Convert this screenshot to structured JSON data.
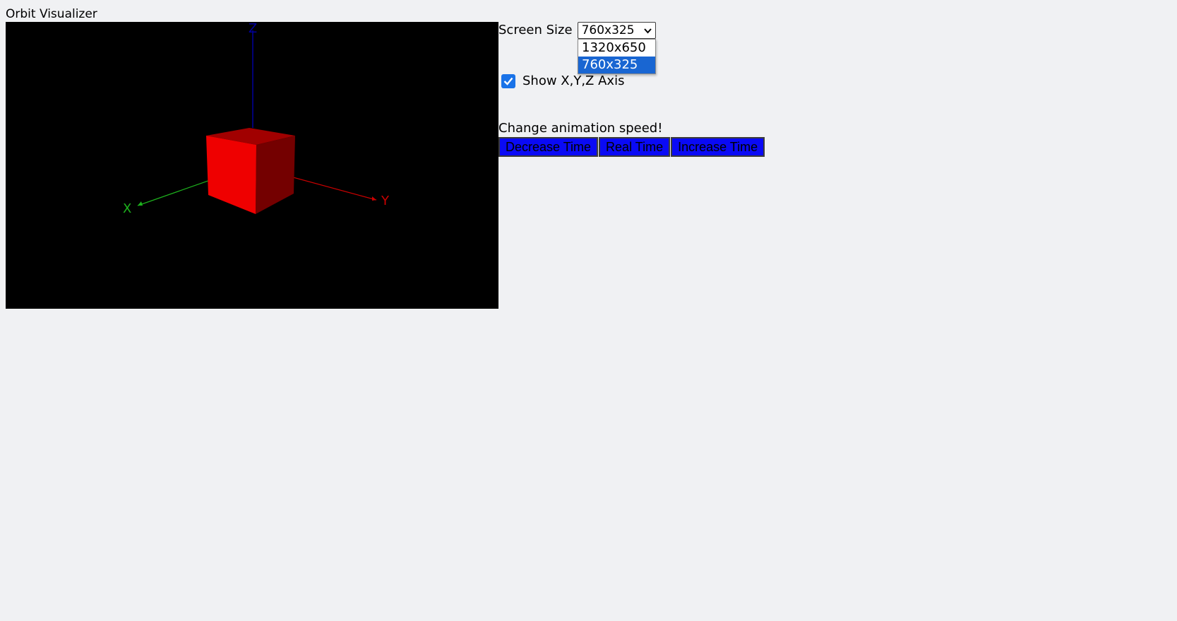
{
  "app": {
    "title": "Orbit Visualizer"
  },
  "scene": {
    "axes": {
      "x_label": "X",
      "y_label": "Y",
      "z_label": "Z"
    },
    "colors": {
      "background": "#000000",
      "x_axis": "#1db11d",
      "y_axis": "#cc0000",
      "z_axis": "#00009c",
      "cube_front": "#ef0000",
      "cube_top": "#a10000",
      "cube_side": "#740000"
    }
  },
  "controls": {
    "screen_size": {
      "label": "Screen Size",
      "selected": "760x325",
      "options": [
        "1320x650",
        "760x325"
      ]
    },
    "show_axis": {
      "label": "Show X,Y,Z Axis",
      "checked": true
    },
    "speed": {
      "label": "Change animation speed!",
      "decrease": "Decrease Time",
      "real": "Real Time",
      "increase": "Increase Time"
    }
  }
}
